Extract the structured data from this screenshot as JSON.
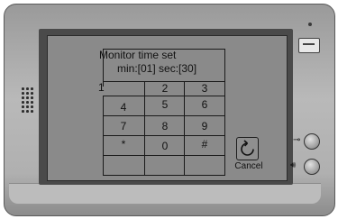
{
  "screen": {
    "title": "Monitor time set",
    "timer_text": "min:[01]  sec:[30]",
    "stray_digit": "1"
  },
  "keypad": {
    "rows": [
      [
        "",
        "2",
        "3"
      ],
      [
        "4",
        "5",
        "6"
      ],
      [
        "7",
        "8",
        "9"
      ],
      [
        "*",
        "0",
        "#"
      ]
    ]
  },
  "cancel": {
    "label": "Cancel",
    "icon": "refresh-icon"
  },
  "hardware": {
    "led": "indicator-led",
    "card_slot": "card-icon",
    "unlock_button_icon": "key-icon",
    "talk_button_icon": "speaker-icon"
  },
  "colors": {
    "screen": "#8a8a8a",
    "body": "#b0b0b0",
    "frame": "#4a4a4a"
  }
}
